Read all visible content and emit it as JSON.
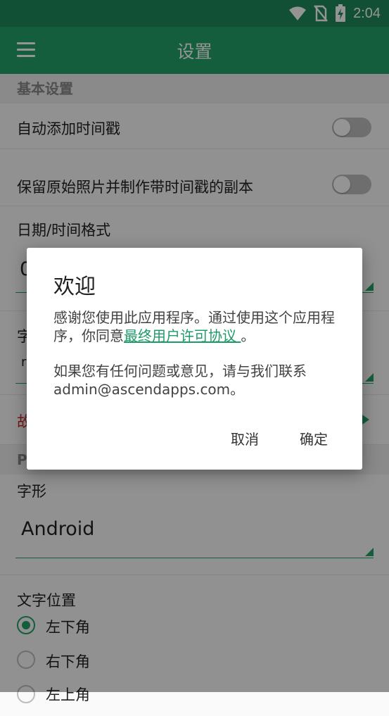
{
  "statusbar": {
    "time": "2:04"
  },
  "toolbar": {
    "title": "设置"
  },
  "basic": {
    "header": "基本设置",
    "auto_timestamp": "自动添加时间戳",
    "keep_original": "保留原始照片并制作带时间戳的副本",
    "datetime_format_label": "日期/时间格式",
    "datetime_format_value": "0",
    "font_label_partial": "字",
    "font_value_partial": "r",
    "faq_partial": "故"
  },
  "photo": {
    "header_partial": "P",
    "glyph_label": "字形",
    "glyph_value": "Android",
    "text_position_label": "文字位置",
    "positions": [
      "左下角",
      "右下角",
      "左上角"
    ]
  },
  "dialog": {
    "title": "欢迎",
    "body_prefix": "感谢您使用此应用程序。通过使用这个应用程序，你同意",
    "link_text": "最终用户许可协议 ",
    "body_suffix": "。",
    "contact": "如果您有任何问题或意见，请与我们联系admin@ascendapps.com。",
    "cancel": "取消",
    "ok": "确定"
  },
  "colors": {
    "primary": "#23a26a",
    "status": "#1e8a5a",
    "link": "#1f9b6a"
  }
}
